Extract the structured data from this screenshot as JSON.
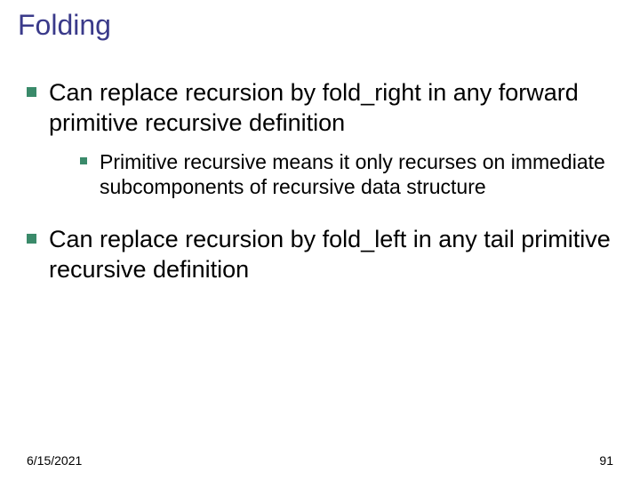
{
  "title": "Folding",
  "bullets": {
    "b1": "Can replace recursion by fold_right in any forward primitive recursive definition",
    "b1a": "Primitive recursive means it only recurses on immediate subcomponents of recursive data structure",
    "b2": "Can replace recursion by fold_left in any tail primitive recursive definition"
  },
  "footer": {
    "date": "6/15/2021",
    "page": "91"
  }
}
